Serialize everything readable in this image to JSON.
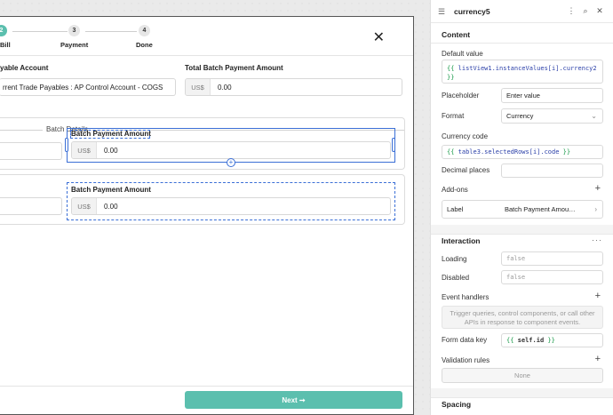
{
  "stepper": {
    "steps": [
      {
        "number": "2",
        "label": "Bill"
      },
      {
        "number": "3",
        "label": "Payment"
      },
      {
        "number": "4",
        "label": "Done"
      }
    ]
  },
  "modal": {
    "close_symbol": "✕",
    "payable_account": {
      "label": "yable Account",
      "value": "rrent Trade Payables : AP Control Account - COGS"
    },
    "total_batch": {
      "label": "Total Batch Payment Amount",
      "prefix": "US$",
      "value": "0.00"
    },
    "batch_details_title": "Batch Details",
    "rows": [
      {
        "field_label": "Batch Payment Amount",
        "prefix": "US$",
        "value": "0.00"
      },
      {
        "field_label": "Batch Payment Amount",
        "prefix": "US$",
        "value": "0.00"
      }
    ],
    "next_button": "Next ➞"
  },
  "panel": {
    "component_name": "currency5",
    "content_title": "Content",
    "default_value_label": "Default value",
    "default_value": {
      "open": "{{",
      "expr": "listView1.instanceValues[i].currency2",
      "close": "}}"
    },
    "placeholder_label": "Placeholder",
    "placeholder_value": "Enter value",
    "format_label": "Format",
    "format_value": "Currency",
    "currency_code_label": "Currency code",
    "currency_code": {
      "open": "{{",
      "expr": "table3.selectedRows[i].code",
      "close": "}}"
    },
    "decimal_places_label": "Decimal places",
    "addons_label": "Add-ons",
    "addon_label_key": "Label",
    "addon_label_value": "Batch Payment Amou…",
    "interaction_title": "Interaction",
    "loading_label": "Loading",
    "loading_value": "false",
    "disabled_label": "Disabled",
    "disabled_value": "false",
    "event_handlers_label": "Event handlers",
    "event_handlers_hint": "Trigger queries, control components, or call other APIs in response to component events.",
    "form_data_key_label": "Form data key",
    "form_data_key": {
      "open": "{{",
      "expr": "self.id",
      "close": "}}"
    },
    "validation_rules_label": "Validation rules",
    "validation_rules_value": "None",
    "spacing_title": "Spacing"
  },
  "colors": {
    "accent": "#5bbfae",
    "selection": "#3b6fd6"
  }
}
